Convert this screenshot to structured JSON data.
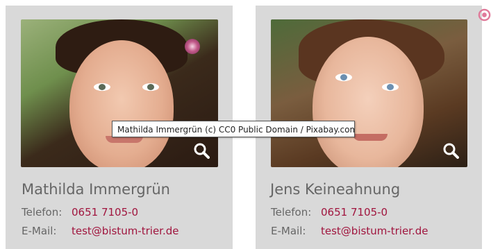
{
  "cards": [
    {
      "name": "Mathilda Immergrün",
      "phone_label": "Telefon:",
      "phone": "0651 7105-0",
      "email_label": "E-Mail:",
      "email": "test@bistum-trier.de",
      "image_alt": "Mathilda Immergrün"
    },
    {
      "name": "Jens Keineahnung",
      "phone_label": "Telefon:",
      "phone": "0651 7105-0",
      "email_label": "E-Mail:",
      "email": "test@bistum-trier.de",
      "image_alt": "Jens Keineahnung"
    }
  ],
  "tooltip": "Mathilda Immergrün (c) CC0 Public Domain / Pixabay.com",
  "colors": {
    "card_bg": "#d9d9d9",
    "link": "#a0153e",
    "text_muted": "#666666",
    "corner_icon": "#e07a9a"
  },
  "icons": {
    "zoom": "magnifier-icon",
    "corner": "record-circle-icon"
  }
}
